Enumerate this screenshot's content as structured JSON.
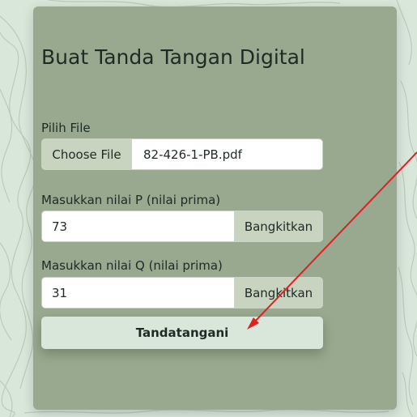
{
  "form": {
    "title": "Buat Tanda Tangan Digital",
    "file_label": "Pilih File",
    "file_button": "Choose File",
    "file_name": "82-426-1-PB.pdf",
    "p_label": "Masukkan nilai P (nilai prima)",
    "p_value": "73",
    "p_button": "Bangkitkan",
    "q_label": "Masukkan nilai Q (nilai prima)",
    "q_value": "31",
    "q_button": "Bangkitkan",
    "submit_label": "Tandatangani"
  },
  "colors": {
    "background": "#d9e7da",
    "card": "#98a98f",
    "input_addon": "#c8d4bf",
    "annotation_arrow": "#e02020"
  },
  "icons": {
    "annotation": "arrow-annotation-icon"
  }
}
